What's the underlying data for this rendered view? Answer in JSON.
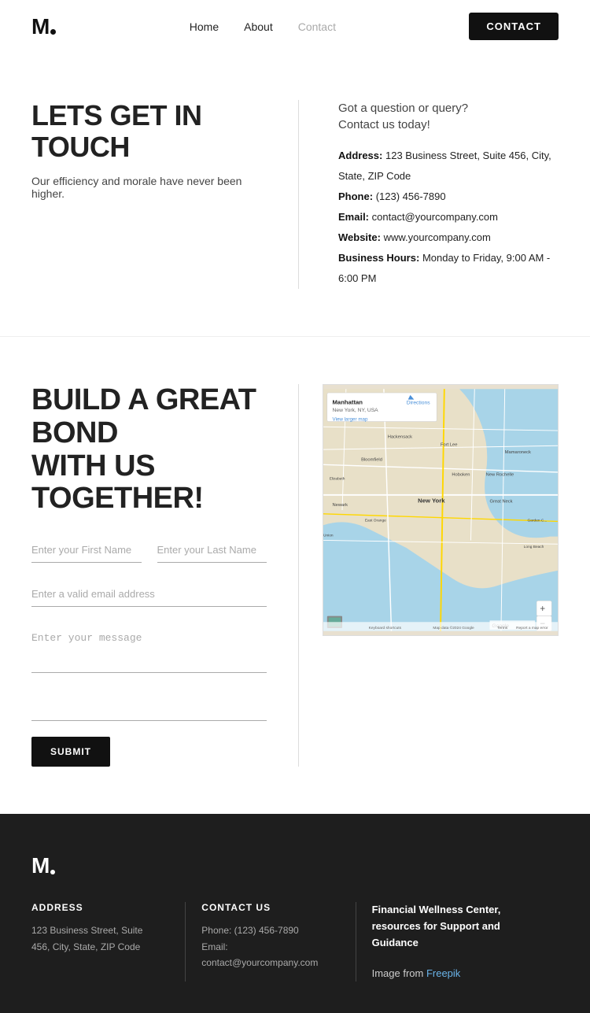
{
  "nav": {
    "logo_text": "M.",
    "links": [
      {
        "label": "Home",
        "active": false
      },
      {
        "label": "About",
        "active": false
      },
      {
        "label": "Contact",
        "active": true
      }
    ],
    "cta_label": "CONTACT"
  },
  "section1": {
    "heading": "LETS GET IN TOUCH",
    "subtext": "Our efficiency and morale have never been higher.",
    "tagline_line1": "Got a question or query?",
    "tagline_line2": "Contact us today!",
    "address_label": "Address:",
    "address_value": "123 Business Street, Suite 456, City, State, ZIP Code",
    "phone_label": "Phone:",
    "phone_value": "(123) 456-7890",
    "email_label": "Email:",
    "email_value": "contact@yourcompany.com",
    "website_label": "Website:",
    "website_value": "www.yourcompany.com",
    "hours_label": "Business Hours:",
    "hours_value": "Monday to Friday, 9:00 AM - 6:00 PM"
  },
  "section2": {
    "heading_line1": "BUILD A GREAT BOND",
    "heading_line2": "WITH US TOGETHER!",
    "form": {
      "first_name_placeholder": "Enter your First Name",
      "last_name_placeholder": "Enter your Last Name",
      "email_placeholder": "Enter a valid email address",
      "message_placeholder": "Enter your message",
      "extra_placeholder": "",
      "submit_label": "SUBMIT"
    }
  },
  "footer": {
    "logo": "M.",
    "address_label": "ADDRESS",
    "address_text": "123 Business Street, Suite 456, City, State, ZIP Code",
    "contact_label": "CONTACT US",
    "phone_text": "Phone: (123) 456-7890",
    "email_text": "Email: contact@yourcompany.com",
    "resource_heading": "Financial Wellness Center, resources for Support and Guidance",
    "resource_text": "Image from ",
    "resource_link": "Freepik"
  }
}
